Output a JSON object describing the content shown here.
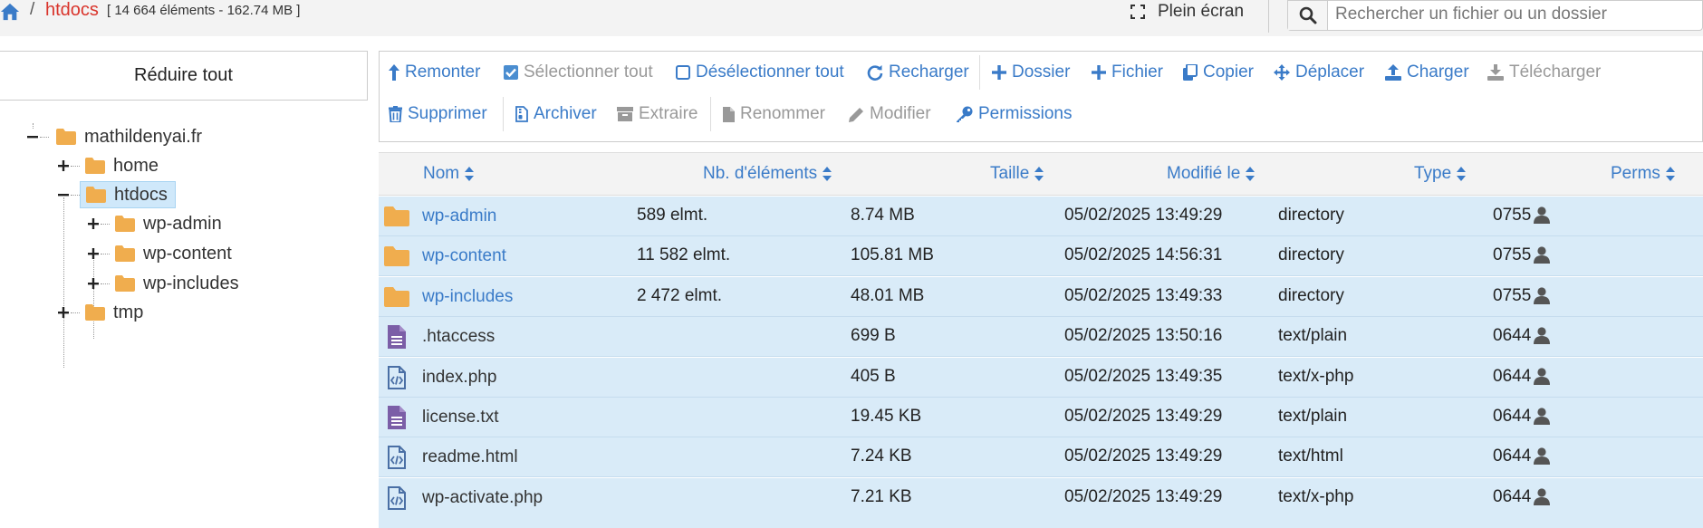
{
  "breadcrumb": {
    "separator": "/",
    "current": "htdocs",
    "stats": "[ 14 664 éléments - 162.74 MB ]"
  },
  "header": {
    "fullscreen_label": "Plein écran",
    "search_placeholder": "Rechercher un fichier ou un dossier"
  },
  "tree": {
    "collapse_label": "Réduire tout",
    "nodes": [
      {
        "label": "mathildenyai.fr",
        "state": "expanded",
        "selected": false
      },
      {
        "label": "home",
        "state": "collapsed",
        "selected": false
      },
      {
        "label": "htdocs",
        "state": "expanded",
        "selected": true
      },
      {
        "label": "wp-admin",
        "state": "collapsed",
        "selected": false
      },
      {
        "label": "wp-content",
        "state": "collapsed",
        "selected": false
      },
      {
        "label": "wp-includes",
        "state": "collapsed",
        "selected": false
      },
      {
        "label": "tmp",
        "state": "collapsed",
        "selected": false
      }
    ]
  },
  "toolbar": {
    "row1": [
      {
        "label": "Remonter",
        "icon": "level-up-icon",
        "enabled": true
      },
      {
        "label": "Sélectionner tout",
        "icon": "checked-box-icon",
        "enabled": false
      },
      {
        "label": "Désélectionner tout",
        "icon": "empty-box-icon",
        "enabled": true
      },
      {
        "label": "Recharger",
        "icon": "refresh-icon",
        "enabled": true
      },
      {
        "label": "Dossier",
        "icon": "plus-icon",
        "enabled": true
      },
      {
        "label": "Fichier",
        "icon": "plus-icon",
        "enabled": true
      },
      {
        "label": "Copier",
        "icon": "copy-icon",
        "enabled": true
      },
      {
        "label": "Déplacer",
        "icon": "move-icon",
        "enabled": true
      },
      {
        "label": "Charger",
        "icon": "upload-icon",
        "enabled": true
      },
      {
        "label": "Télécharger",
        "icon": "download-icon",
        "enabled": false
      }
    ],
    "row2": [
      {
        "label": "Supprimer",
        "icon": "trash-icon",
        "enabled": true
      },
      {
        "label": "Archiver",
        "icon": "archive-file-icon",
        "enabled": true
      },
      {
        "label": "Extraire",
        "icon": "archive-box-icon",
        "enabled": false
      },
      {
        "label": "Renommer",
        "icon": "file-icon",
        "enabled": false
      },
      {
        "label": "Modifier",
        "icon": "pencil-icon",
        "enabled": false
      },
      {
        "label": "Permissions",
        "icon": "key-icon",
        "enabled": true
      }
    ]
  },
  "table": {
    "columns": [
      "Nom",
      "Nb. d'éléments",
      "Taille",
      "Modifié le",
      "Type",
      "Perms"
    ],
    "rows": [
      {
        "name": "wp-admin",
        "kind": "folder",
        "count": "589 elmt.",
        "size": "8.74 MB",
        "modified": "05/02/2025 13:49:29",
        "type": "directory",
        "perms": "0755"
      },
      {
        "name": "wp-content",
        "kind": "folder",
        "count": "11 582 elmt.",
        "size": "105.81 MB",
        "modified": "05/02/2025 14:56:31",
        "type": "directory",
        "perms": "0755"
      },
      {
        "name": "wp-includes",
        "kind": "folder",
        "count": "2 472 elmt.",
        "size": "48.01 MB",
        "modified": "05/02/2025 13:49:33",
        "type": "directory",
        "perms": "0755"
      },
      {
        "name": ".htaccess",
        "kind": "text",
        "count": "",
        "size": "699 B",
        "modified": "05/02/2025 13:50:16",
        "type": "text/plain",
        "perms": "0644"
      },
      {
        "name": "index.php",
        "kind": "code",
        "count": "",
        "size": "405 B",
        "modified": "05/02/2025 13:49:35",
        "type": "text/x-php",
        "perms": "0644"
      },
      {
        "name": "license.txt",
        "kind": "text",
        "count": "",
        "size": "19.45 KB",
        "modified": "05/02/2025 13:49:29",
        "type": "text/plain",
        "perms": "0644"
      },
      {
        "name": "readme.html",
        "kind": "code",
        "count": "",
        "size": "7.24 KB",
        "modified": "05/02/2025 13:49:29",
        "type": "text/html",
        "perms": "0644"
      },
      {
        "name": "wp-activate.php",
        "kind": "code",
        "count": "",
        "size": "7.21 KB",
        "modified": "05/02/2025 13:49:29",
        "type": "text/x-php",
        "perms": "0644"
      }
    ]
  },
  "colors": {
    "link": "#3a7bc8",
    "breadcrumb_current": "#d9342b",
    "folder": "#f0ad4e",
    "text_file": "#7b5ea7",
    "code_file": "#4a6fa5",
    "row_bg": "#d9ebf8",
    "selected_node_bg": "#cfe8fa"
  }
}
